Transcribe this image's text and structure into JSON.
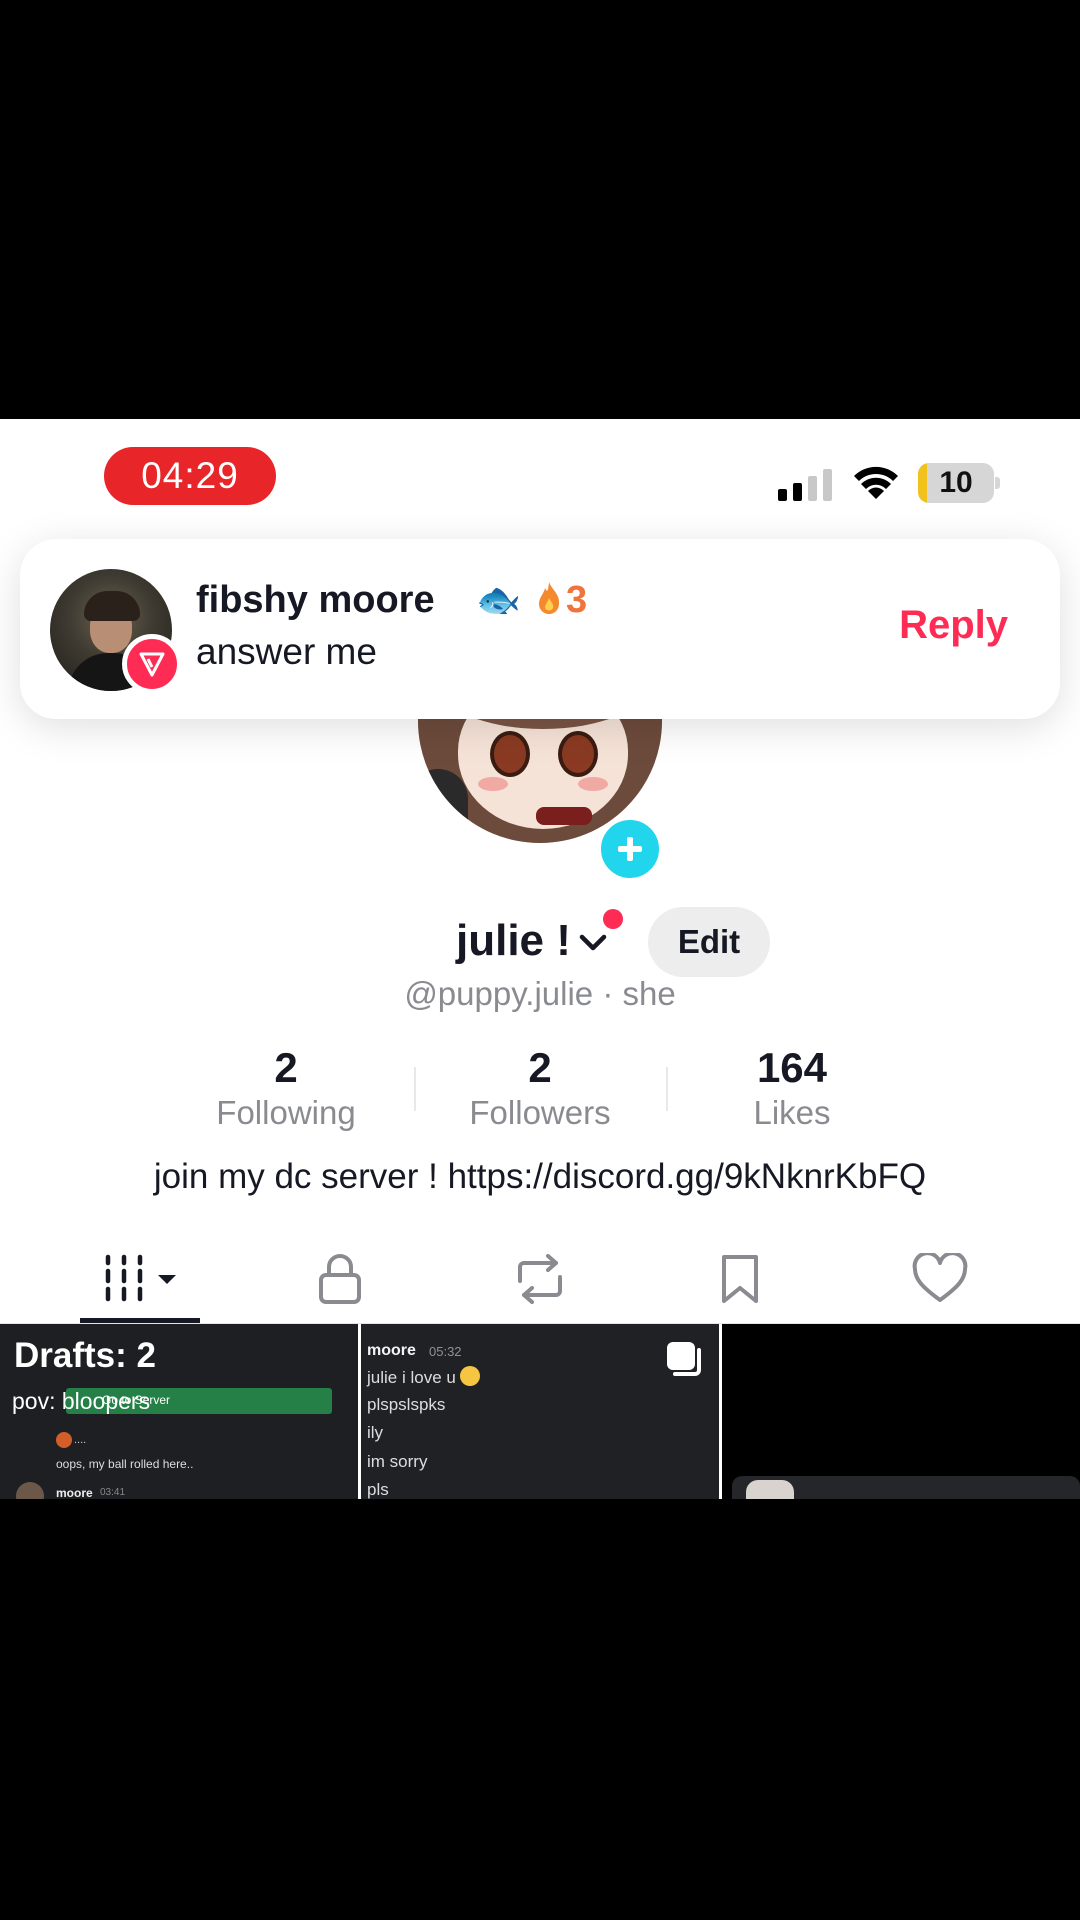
{
  "status_bar": {
    "time": "04:29",
    "battery_level": "10",
    "battery_fraction": 0.12,
    "colors": {
      "time_pill": "#e8262a",
      "battery_fill": "#f1c21b"
    }
  },
  "notification": {
    "sender_name": "fibshy  moore",
    "fish_emoji": "🐟",
    "streak_count": "3",
    "message": "answer me",
    "reply_label": "Reply",
    "colors": {
      "reply": "#fe2c55",
      "streak": "#f0733b"
    }
  },
  "profile": {
    "display_name": "julie !",
    "edit_label": "Edit",
    "handle": "@puppy.julie · she",
    "bio": "join my dc server ! https://discord.gg/9kNknrKbFQ",
    "stats": [
      {
        "value": "2",
        "label": "Following"
      },
      {
        "value": "2",
        "label": "Followers"
      },
      {
        "value": "164",
        "label": "Likes"
      }
    ]
  },
  "tabs": [
    {
      "icon": "videos-grid-icon",
      "selected": true
    },
    {
      "icon": "lock-icon",
      "selected": false
    },
    {
      "icon": "repost-icon",
      "selected": false
    },
    {
      "icon": "bookmark-icon",
      "selected": false
    },
    {
      "icon": "heart-icon",
      "selected": false
    }
  ],
  "grid": {
    "drafts": {
      "label": "Drafts: 2",
      "caption": "pov: bloopers",
      "server_button": "Go to Server",
      "dots": "....",
      "message": "oops, my ball rolled here..",
      "username": "moore",
      "time": "03:41"
    },
    "chat": {
      "username": "moore",
      "time": "05:32",
      "lines": [
        "julie i love u",
        "plspslspks",
        "ily",
        "im sorry",
        "pls"
      ]
    }
  }
}
